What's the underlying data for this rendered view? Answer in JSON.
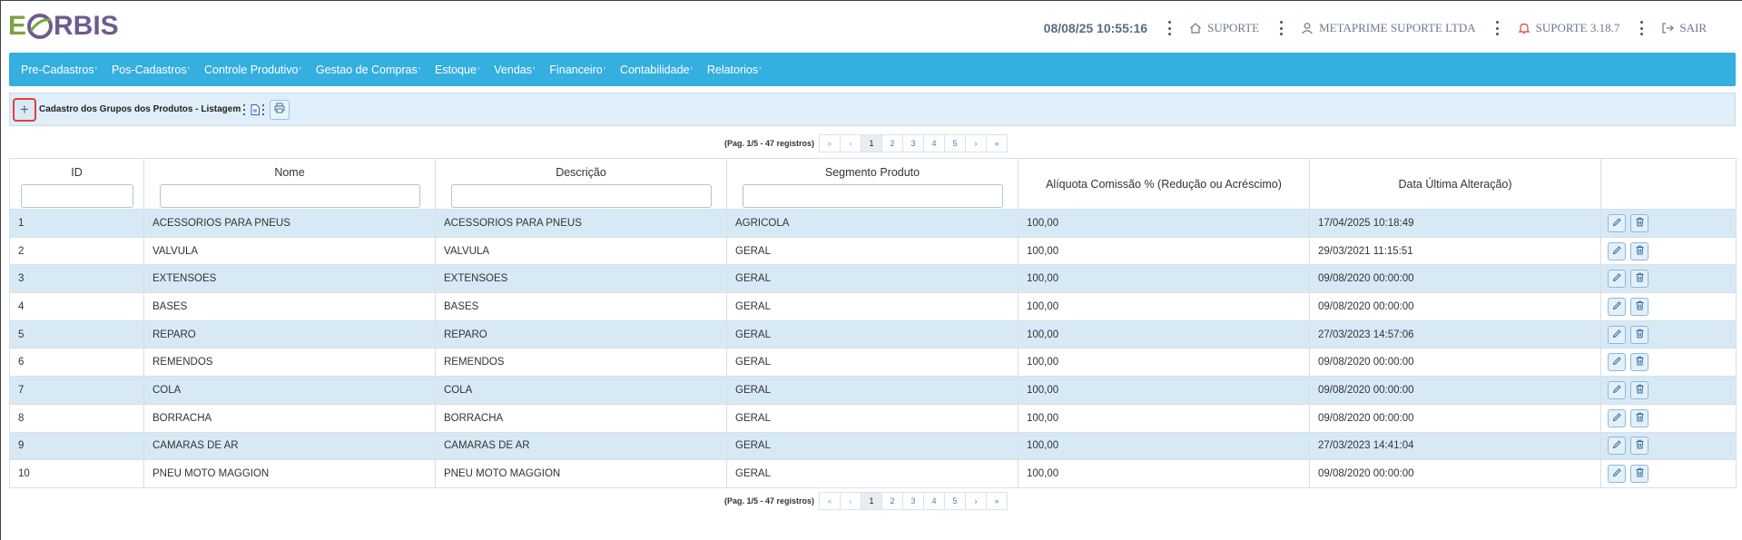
{
  "brand": {
    "logo_letter": "E",
    "logo_rest": "RBIS",
    "green": "#7aa342",
    "purple": "#6e5b8f"
  },
  "header": {
    "datetime": "08/08/25 10:55:16",
    "home_label": "SUPORTE",
    "user_label": "METAPRIME SUPORTE LTDA",
    "bell_label": "SUPORTE 3.18.7",
    "logout_label": "SAIR"
  },
  "nav": {
    "items": [
      "Pre-Cadastros",
      "Pos-Cadastros",
      "Controle Produtivo",
      "Gestao de Compras",
      "Estoque",
      "Vendas",
      "Financeiro",
      "Contabilidade",
      "Relatorios"
    ],
    "accent": "#35aee0"
  },
  "toolbar": {
    "title": "Cadastro dos Grupos dos Produtos - Listagem"
  },
  "pagination": {
    "info": "(Pag. 1/5 - 47 registros)",
    "first": "«",
    "prev": "‹",
    "next": "›",
    "last": "»",
    "pages": [
      "1",
      "2",
      "3",
      "4",
      "5"
    ],
    "active_page": "1"
  },
  "table": {
    "columns": [
      "ID",
      "Nome",
      "Descrição",
      "Segmento Produto",
      "Alíquota Comissão % (Redução ou Acréscimo)",
      "Data Última Alteração)"
    ],
    "rows": [
      [
        "1",
        "ACESSORIOS PARA PNEUS",
        "ACESSORIOS PARA PNEUS",
        "AGRICOLA",
        "100,00",
        "17/04/2025 10:18:49"
      ],
      [
        "2",
        "VALVULA",
        "VALVULA",
        "GERAL",
        "100,00",
        "29/03/2021 11:15:51"
      ],
      [
        "3",
        "EXTENSOES",
        "EXTENSOES",
        "GERAL",
        "100,00",
        "09/08/2020 00:00:00"
      ],
      [
        "4",
        "BASES",
        "BASES",
        "GERAL",
        "100,00",
        "09/08/2020 00:00:00"
      ],
      [
        "5",
        "REPARO",
        "REPARO",
        "GERAL",
        "100,00",
        "27/03/2023 14:57:06"
      ],
      [
        "6",
        "REMENDOS",
        "REMENDOS",
        "GERAL",
        "100,00",
        "09/08/2020 00:00:00"
      ],
      [
        "7",
        "COLA",
        "COLA",
        "GERAL",
        "100,00",
        "09/08/2020 00:00:00"
      ],
      [
        "8",
        "BORRACHA",
        "BORRACHA",
        "GERAL",
        "100,00",
        "09/08/2020 00:00:00"
      ],
      [
        "9",
        "CAMARAS DE AR",
        "CAMARAS DE AR",
        "GERAL",
        "100,00",
        "27/03/2023 14:41:04"
      ],
      [
        "10",
        "PNEU MOTO MAGGION",
        "PNEU MOTO MAGGION",
        "GERAL",
        "100,00",
        "09/08/2020 00:00:00"
      ]
    ],
    "row_actions": [
      "edit-icon",
      "trash-icon"
    ],
    "stripe_color": "#d8e9f6"
  }
}
